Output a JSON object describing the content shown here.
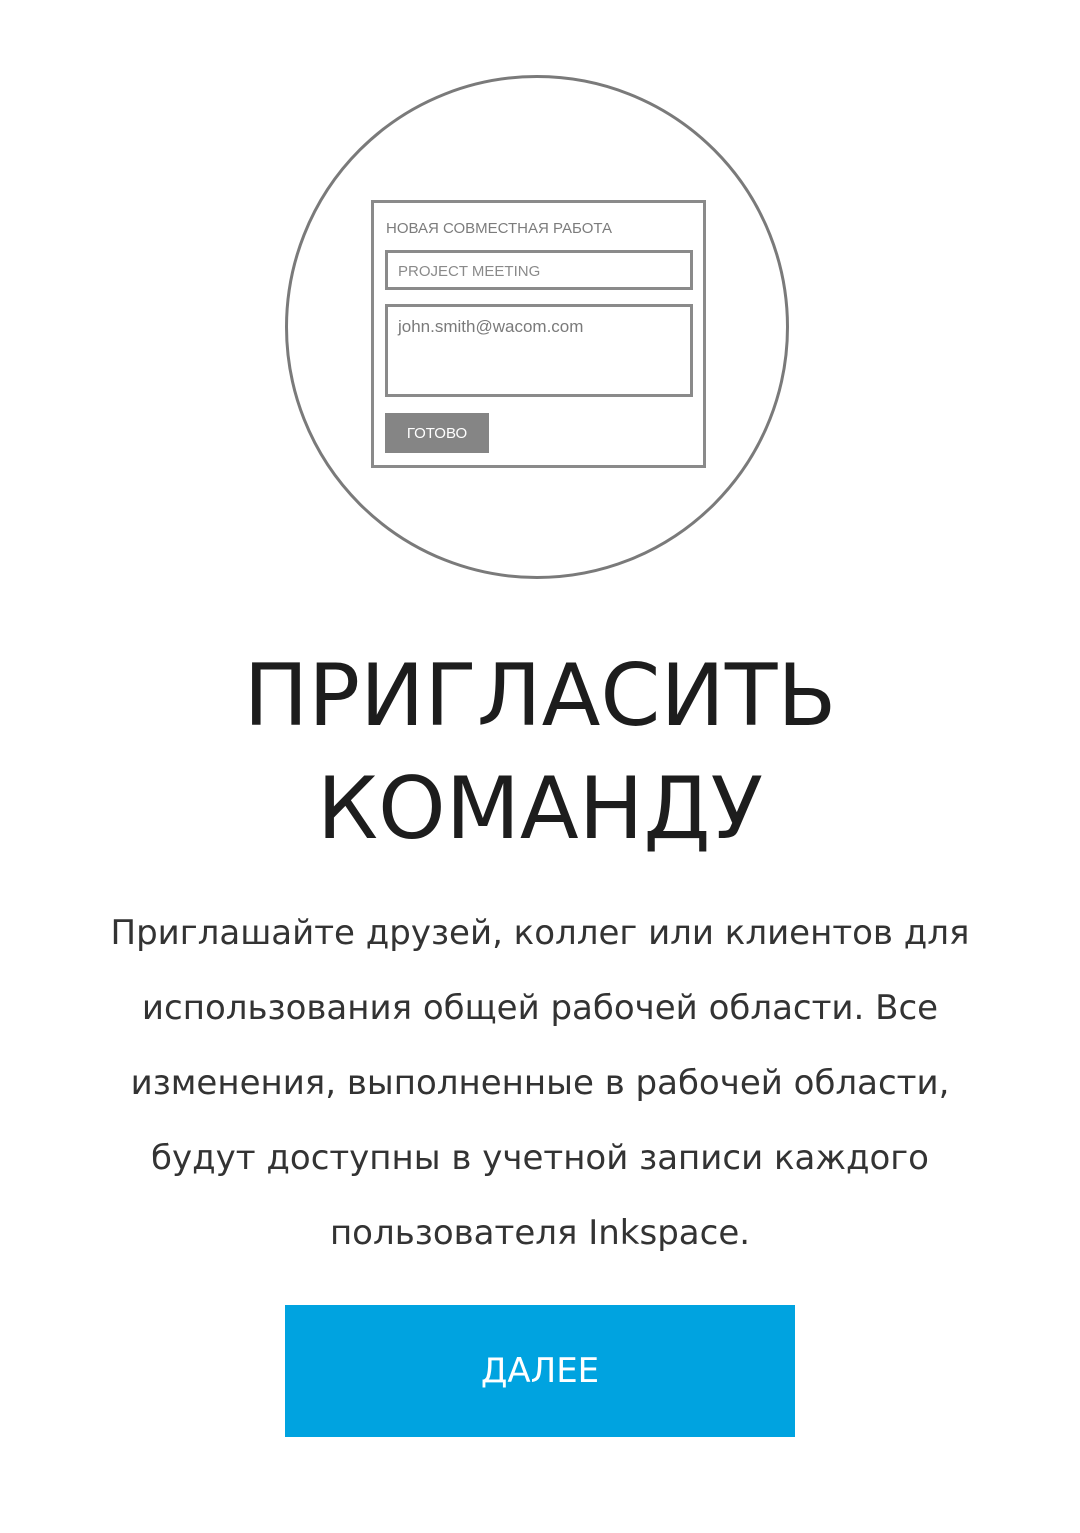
{
  "illustration": {
    "form_title": "НОВАЯ СОВМЕСТНАЯ РАБОТА",
    "name_value": "PROJECT MEETING",
    "email_value": "john.smith@wacom.com",
    "done_label": "ГОТОВО"
  },
  "title": {
    "line1": "ПРИГЛАСИТЬ",
    "line2": "КОМАНДУ"
  },
  "description": {
    "line1": "Приглашайте друзей, коллег или клиентов для",
    "line2": "использования общей рабочей области. Все",
    "line3": "изменения, выполненные в рабочей области,",
    "line4": "будут доступны в учетной записи каждого",
    "line5": "пользователя Inkspace."
  },
  "next_label": "ДАЛЕЕ",
  "colors": {
    "accent": "#00a3e0",
    "illustration_gray": "#858585"
  }
}
